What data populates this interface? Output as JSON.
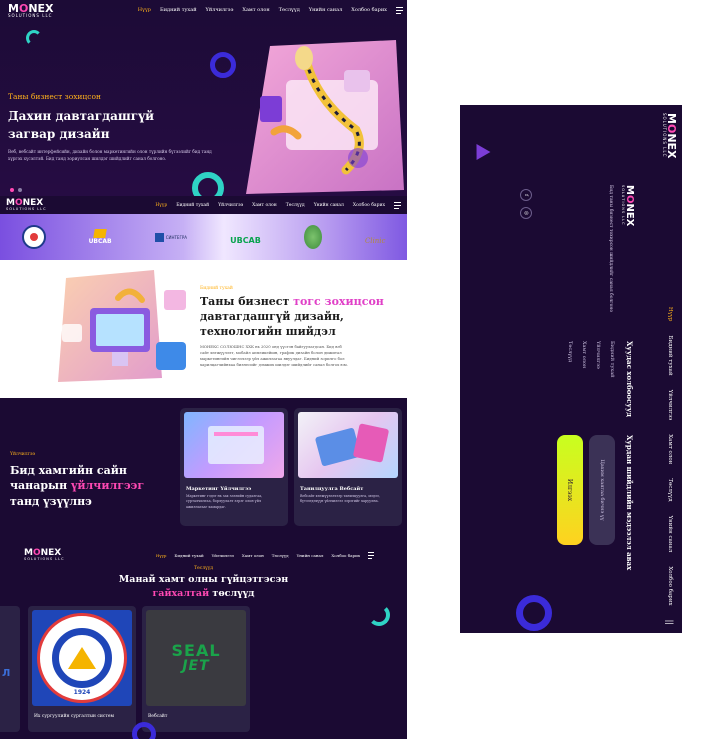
{
  "brand": {
    "name": "MONEX",
    "tagline": "SOLUTIONS LLC"
  },
  "nav": {
    "items": [
      "Нүүр",
      "Бидний тухай",
      "Үйлчилгээ",
      "Хамт олон",
      "Төслүүд",
      "Үнийн санал",
      "Холбоо барих"
    ],
    "active": "Нүүр"
  },
  "hero": {
    "eyebrow": "Таны бизнест зохицсон",
    "title_line1": "Дахин давтагдашгүй",
    "title_line2": "загвар дизайн",
    "body": "Веб, вебсайт интерфейсийн, дизайн болон маркетингийн олон түрлийн бүтээлийг бид танд хүргэх хүсэлтэй. Бид танд зориулсан шилдэг шийдлийг санал болгоно.",
    "slides": 2
  },
  "partners": [
    "ЗАСГИЙН ИХ СУРГУУЛЬ",
    "UBCAB",
    "СИНТЕГРА",
    "UBCAB",
    "ECO",
    "Clinic"
  ],
  "about": {
    "eyebrow": "Бидний тухай",
    "title_line1": "Таны бизнест ",
    "title_highlight": "тогс зохицсон",
    "title_line2": "давтагдашгүй дизайн,",
    "title_line3": "технологийн шийдэл",
    "body": "МОНЕКС СОЛЮШНС ХХК нь 2020 онд үүсгэн байгуулагдсан. Бид вэб сайт хөгжүүлэлт, мобайл аппликейшн, график дизайн болон дижитал маркетингийн чиглэлээр үйл ажиллагаа явуулдаг. Бидний зорилго бол харилцагчийнхаа бизнесийг дэмжих шилдэг шийдлийг санал болгох юм."
  },
  "services": {
    "eyebrow": "Үйлчилгээ",
    "title_line1": "Бид хамгийн сайн",
    "title_pre": "чанарын ",
    "title_highlight": "үйлчилгээг",
    "title_line3": "танд үзүүлнэ",
    "cards": [
      {
        "title": "Маркетинг Үйлчилгээ",
        "body": "Маркетинг гэдэг нь зах зээлийн судалгаа, сурталчилгаа, борлуулалт зэрэг олон үйл ажиллагааг хамардаг."
      },
      {
        "title": "Танилцуулга Вебсайт",
        "body": "Вебсайт хөгжүүлэлтээр танилцуулга, мэдээ, бүтээгдэхүүн үйлчилгээ зэрэгийг харуулна."
      }
    ]
  },
  "portfolio": {
    "eyebrow": "Төслүүд",
    "title_line1": "Манай хамт олны гүйцэтгэсэн",
    "title_highlight": "гайхалтай",
    "title_line2": " төслүүд",
    "cards": [
      {
        "label": "Их сургуулийн сургалтын систем",
        "logo_text": "ЗАСГИЙН ИХ СУРГУУЛЬ",
        "year": "1924"
      },
      {
        "label": "Вебсайт",
        "logo_text": "SEAL JET"
      }
    ]
  },
  "mobile_menu": {
    "title": "Хуудас холбоосууд",
    "links": [
      "Бидний тухай",
      "Үйлчилгээ",
      "Хамт олон",
      "Төслүүд"
    ],
    "about_title": "Бид таны бизнест тохирсон шийдлийг санал болгоно",
    "cta_title": "Хурдан шийдлийн мэдээлэл авах",
    "cta_primary": "Илгээх",
    "cta_secondary": "Цахим хаягаа бичнэ үү",
    "social": [
      "f",
      "◎"
    ]
  },
  "colors": {
    "bg": "#1b0a33",
    "accent": "#ffb21b",
    "pink": "#ff49b3",
    "lime": "#c8ff1f",
    "teal": "#2fd3c5",
    "blue": "#3b2bd9"
  }
}
